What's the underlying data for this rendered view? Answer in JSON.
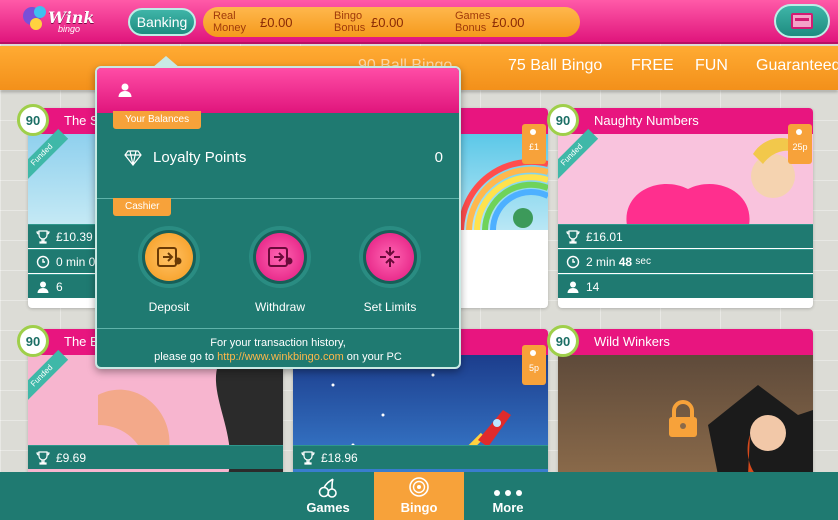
{
  "header": {
    "logo_text": "Wink",
    "logo_sub": "bingo",
    "banking_label": "Banking",
    "balances": [
      {
        "label_line1": "Real",
        "label_line2": "Money",
        "value": "£0.00"
      },
      {
        "label_line1": "Bingo",
        "label_line2": "Bonus",
        "value": "£0.00"
      },
      {
        "label_line1": "Games",
        "label_line2": "Bonus",
        "value": "£0.00"
      }
    ]
  },
  "categories": [
    "90 Ball Bingo",
    "75 Ball Bingo",
    "FREE",
    "FUN",
    "Guaranteed"
  ],
  "cards": [
    {
      "badge": "90",
      "title": "The Stre",
      "price": "",
      "funded": "Funded",
      "prize": "£10.39",
      "time": "0 min 0",
      "players": "6"
    },
    {
      "badge": "",
      "title": "",
      "price": "£1",
      "funded": "",
      "prize": "",
      "time": "",
      "players": ""
    },
    {
      "badge": "90",
      "title": "Naughty Numbers",
      "price": "25p",
      "funded": "Funded",
      "prize": "£16.01",
      "time_min": "2",
      "time_min_label": "min",
      "time_sec": "48",
      "time_sec_label": "sec",
      "players": "14"
    },
    {
      "badge": "90",
      "title": "The Bu",
      "price": "",
      "funded": "Funded",
      "prize": "£9.69",
      "time": "",
      "players": ""
    },
    {
      "badge": "",
      "title": "",
      "price": "5p",
      "funded": "",
      "prize": "£18.96",
      "time": "",
      "players": ""
    },
    {
      "badge": "90",
      "title": "Wild Winkers",
      "price": "",
      "funded": "",
      "prize": "",
      "time": "",
      "players": ""
    }
  ],
  "popup": {
    "balances_label": "Your Balances",
    "loyalty_label": "Loyalty Points",
    "loyalty_value": "0",
    "cashier_label": "Cashier",
    "actions": [
      {
        "label": "Deposit",
        "color": "#f7a23a"
      },
      {
        "label": "Withdraw",
        "color": "#e8157f"
      },
      {
        "label": "Set Limits",
        "color": "#e8157f"
      }
    ],
    "footer_line1": "For your transaction history,",
    "footer_prefix": "please go to",
    "footer_link": "http://www.winkbingo.com",
    "footer_suffix": "on your PC"
  },
  "bottom_nav": [
    {
      "label": "Games",
      "icon": "cherries-icon"
    },
    {
      "label": "Bingo",
      "icon": "bingo-ball-icon"
    },
    {
      "label": "More",
      "icon": "more-dots-icon"
    }
  ],
  "colors": {
    "teal": "#1f7a71",
    "pink": "#e8157f",
    "orange": "#f7a23a",
    "green": "#9fcf4a"
  }
}
